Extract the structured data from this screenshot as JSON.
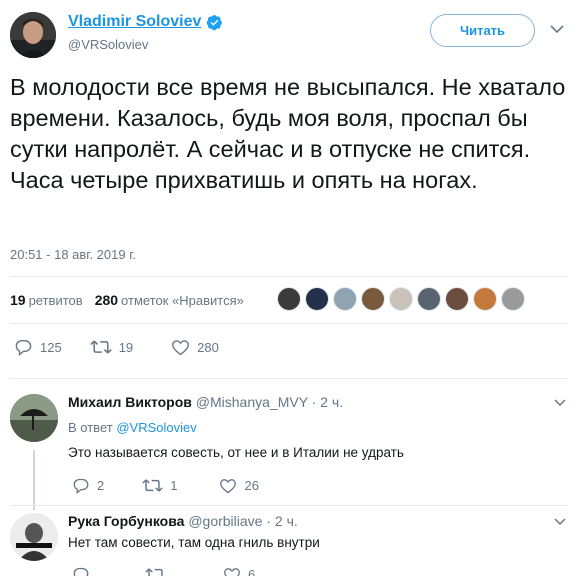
{
  "tweet": {
    "author_name": "Vladimir Soloviev",
    "author_handle": "@VRSoloviev",
    "follow_label": "Читать",
    "text": "В молодости все время не высыпался. Не хватало времени. Казалось, будь моя воля, проспал бы сутки напролёт. А сейчас и в отпуске не спится. Часа четыре прихватишь и опять на ногах.",
    "timestamp": "20:51 - 18 авг. 2019 г.",
    "retweets_count": "19",
    "retweets_label": "ретвитов",
    "likes_count": "280",
    "likes_label": "отметок «Нравится»",
    "actions": {
      "replies": "125",
      "retweets": "19",
      "likes": "280"
    }
  },
  "replies": [
    {
      "name": "Михаил Викторов",
      "handle": "@Mishanya_MVY",
      "time": "· 2 ч.",
      "in_reply_label": "В ответ",
      "in_reply_handle": "@VRSoloviev",
      "text": "Это называется совесть, от нее и в Италии не удрать",
      "actions": {
        "replies": "2",
        "retweets": "1",
        "likes": "26"
      }
    },
    {
      "name": "Рука Горбункова",
      "handle": "@gorbiliave",
      "time": "· 2 ч.",
      "text": "Нет там совести, там одна гниль внутри",
      "actions": {
        "replies": "",
        "retweets": "",
        "likes": "6"
      }
    }
  ],
  "colors": {
    "accent": "#1b95e0",
    "text": "#14171a",
    "muted": "#657786",
    "divider": "#e6ecf0"
  }
}
